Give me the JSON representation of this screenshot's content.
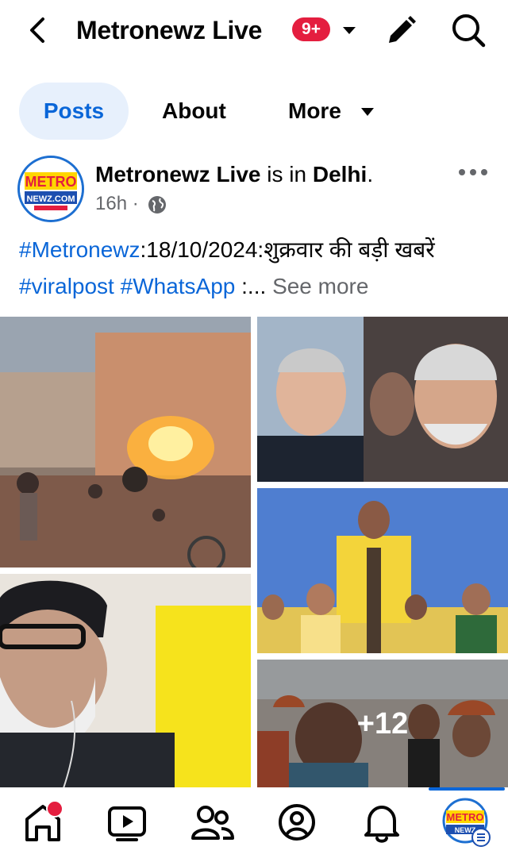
{
  "header": {
    "page_name": "Metronewz Live",
    "badge": "9+",
    "icons": {
      "back": "chevron-left-icon",
      "dropdown": "caret-down-icon",
      "edit": "pencil-icon",
      "search": "search-icon"
    }
  },
  "tabs": [
    {
      "label": "Posts",
      "active": true
    },
    {
      "label": "About",
      "active": false
    },
    {
      "label": "More",
      "active": false
    }
  ],
  "post": {
    "author": "Metronewz Live",
    "location_prefix": " is in ",
    "location": "Delhi",
    "location_suffix": ".",
    "time": "16h",
    "meta_sep": " · ",
    "text": {
      "tag1": "#Metronewz",
      "body1": ":18/10/2024:शुक्रवार की बड़ी खबरें ",
      "tag2": "#viralpost",
      "space": " ",
      "tag3": "#WhatsApp",
      "ellipsis": " :... ",
      "see_more": "See more"
    },
    "more_photos": "+12",
    "avatar_logo": {
      "line1": "METRO",
      "line2": "NEWZ.COM"
    }
  },
  "bottom_nav": [
    {
      "name": "home-icon"
    },
    {
      "name": "video-icon"
    },
    {
      "name": "friends-icon"
    },
    {
      "name": "profile-icon"
    },
    {
      "name": "notifications-bell-icon"
    },
    {
      "name": "page-avatar-menu-icon"
    }
  ],
  "colors": {
    "accent": "#0a66d8",
    "badge": "#e41e3f",
    "muted": "#65676b"
  }
}
